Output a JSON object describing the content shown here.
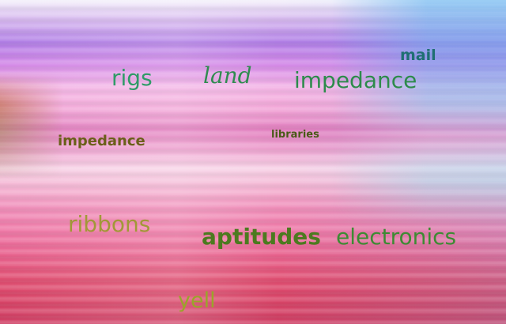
{
  "words": {
    "mail": "mail",
    "rigs": "rigs",
    "land": "land",
    "impedance_top": "impedance",
    "libraries": "libraries",
    "impedance_left": "impedance",
    "ribbons": "ribbons",
    "aptitudes": "aptitudes",
    "electronics": "electronics",
    "yell": "yell"
  }
}
